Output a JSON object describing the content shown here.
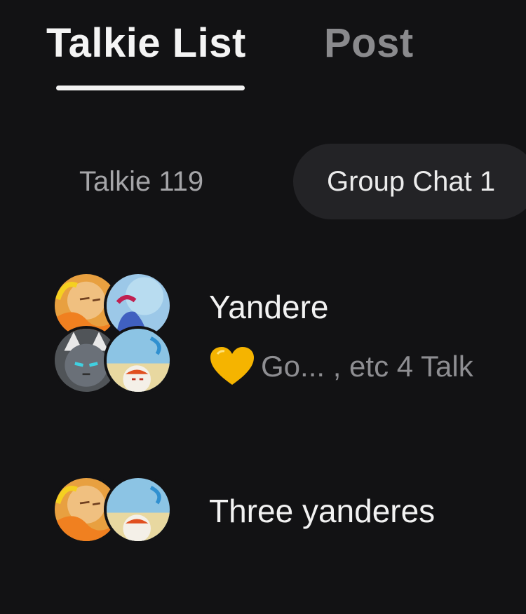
{
  "tabs": {
    "active_label": "Talkie List",
    "inactive_label": "Post"
  },
  "filters": {
    "talkie_label": "Talkie 119",
    "group_chat_label": "Group Chat 1"
  },
  "chats": [
    {
      "title": "Yandere",
      "preview_icon": "yellow-heart-icon",
      "preview_text": "Go... , etc 4 Talk"
    },
    {
      "title": "Three yanderes"
    }
  ],
  "colors": {
    "background": "#121214",
    "chip_background": "#232326",
    "primary_text": "#f2f2f2",
    "secondary_text": "#8e8e92",
    "heart": "#f5b400"
  }
}
